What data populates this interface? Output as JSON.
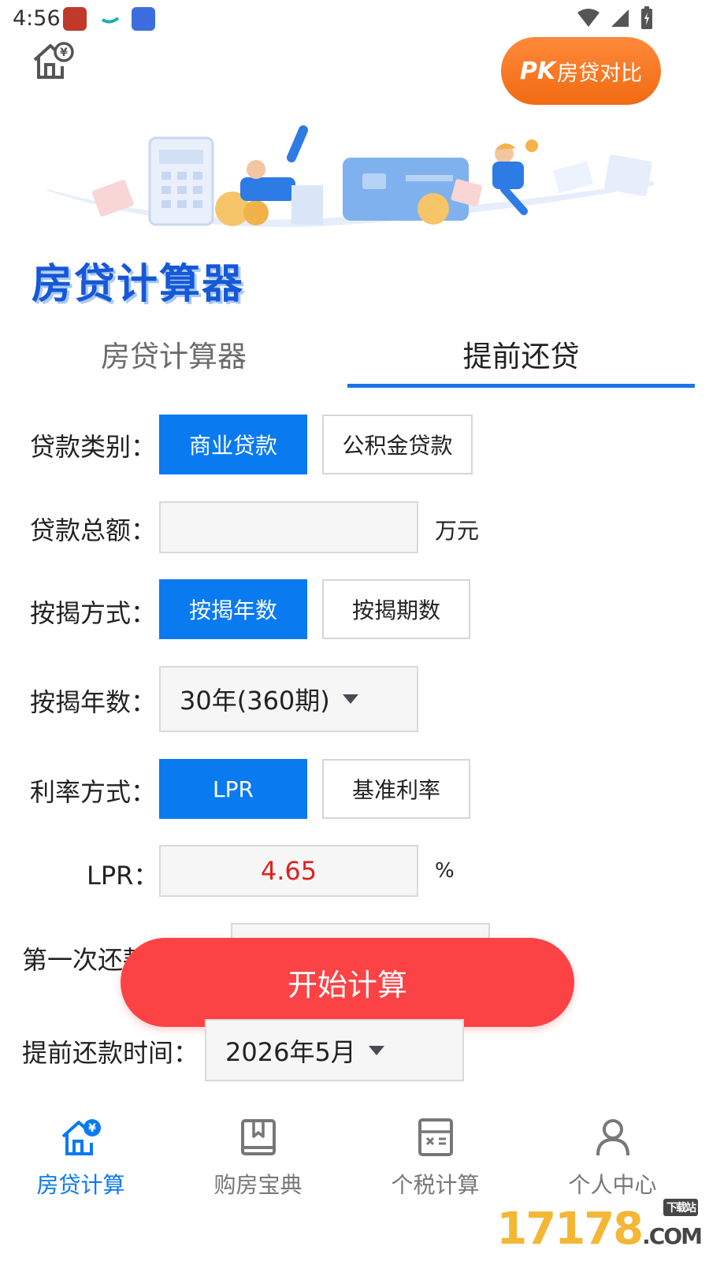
{
  "status": {
    "time": "4:56"
  },
  "header": {
    "pk_prefix": "PK",
    "pk_label": "房贷对比"
  },
  "title": "房贷计算器",
  "tabs": [
    {
      "label": "房贷计算器"
    },
    {
      "label": "提前还贷"
    }
  ],
  "form": {
    "loan_type": {
      "label": "贷款类别：",
      "options": [
        "商业贷款",
        "公积金贷款"
      ],
      "selected": "商业贷款"
    },
    "loan_amount": {
      "label": "贷款总额：",
      "value": "",
      "unit": "万元"
    },
    "mortgage_mode": {
      "label": "按揭方式：",
      "options": [
        "按揭年数",
        "按揭期数"
      ],
      "selected": "按揭年数"
    },
    "mortgage_years": {
      "label": "按揭年数：",
      "value": "30年(360期)"
    },
    "rate_mode": {
      "label": "利率方式：",
      "options": [
        "LPR",
        "基准利率"
      ],
      "selected": "LPR"
    },
    "lpr": {
      "label": "LPR：",
      "value": "4.65",
      "unit": "%"
    },
    "first_repay": {
      "label": "第一次还款"
    },
    "prepay_time": {
      "label": "提前还款时间：",
      "value": "2026年5月"
    }
  },
  "calc_button": "开始计算",
  "nav": [
    {
      "label": "房贷计算",
      "icon": "house-yen-icon"
    },
    {
      "label": "购房宝典",
      "icon": "book-icon"
    },
    {
      "label": "个税计算",
      "icon": "tax-calculator-icon"
    },
    {
      "label": "个人中心",
      "icon": "person-icon"
    }
  ],
  "watermark": {
    "text": "17178",
    "suffix": ".COM",
    "tag": "下载站"
  },
  "colors": {
    "accent": "#0a7af0",
    "calc_button": "#fb4346",
    "pk_button": "#f26a13",
    "lpr_value": "#e02020"
  }
}
